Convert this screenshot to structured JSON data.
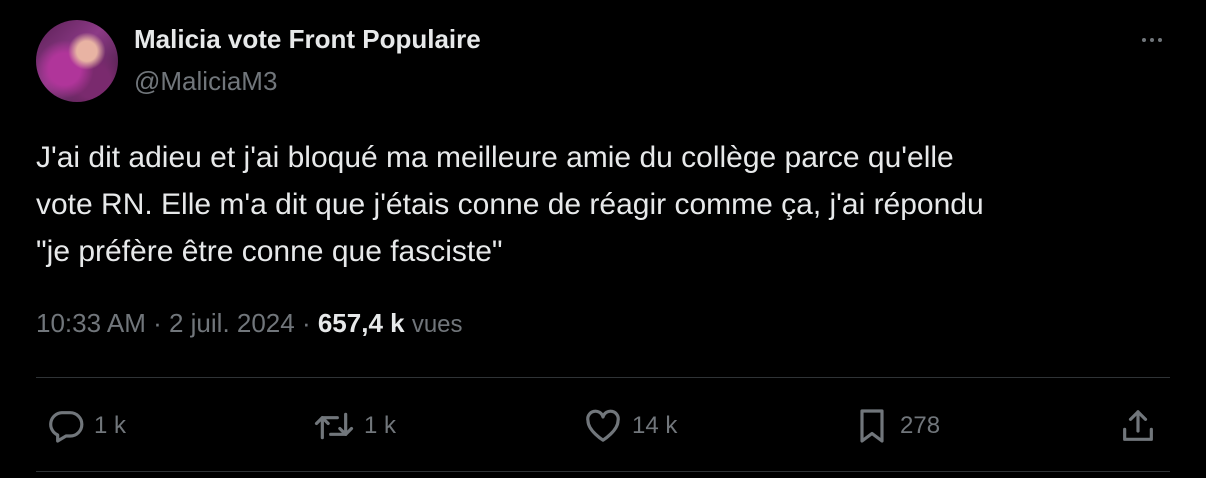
{
  "author": {
    "display_name": "Malicia vote Front Populaire",
    "handle": "@MaliciaM3"
  },
  "tweet": {
    "lines": [
      "J'ai dit adieu et j'ai bloqué ma meilleure amie du collège parce qu'elle",
      "vote RN. Elle m'a dit que j'étais conne de réagir comme ça, j'ai répondu",
      "\"je préfère être conne que fasciste\""
    ]
  },
  "meta": {
    "time": "10:33 AM",
    "separator1": " · ",
    "date": "2 juil. 2024",
    "separator2": " · ",
    "views_count": "657,4 k",
    "views_label": "vues"
  },
  "actions": {
    "reply": {
      "icon": "reply-icon",
      "count": "1 k"
    },
    "retweet": {
      "icon": "retweet-icon",
      "count": "1 k"
    },
    "like": {
      "icon": "heart-icon",
      "count": "14 k"
    },
    "bookmark": {
      "icon": "bookmark-icon",
      "count": "278"
    },
    "share": {
      "icon": "share-icon"
    }
  },
  "colors": {
    "background": "#000000",
    "text_primary": "#e7e9ea",
    "text_secondary": "#71767b",
    "divider": "#2f3336"
  }
}
